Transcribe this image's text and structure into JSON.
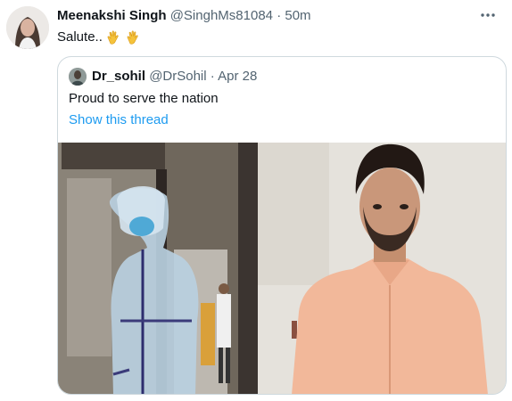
{
  "tweet": {
    "name": "Meenakshi Singh",
    "handle": "@SinghMs81084",
    "separator": "·",
    "time": "50m",
    "text": "Salute..",
    "more_icon": "more-horizontal-icon",
    "emojis": [
      "clapping-hands-icon",
      "clapping-hands-icon"
    ]
  },
  "quoted": {
    "name": "Dr_sohil",
    "handle": "@DrSohil",
    "separator": "·",
    "date": "Apr 28",
    "text": "Proud to serve the nation",
    "show_thread": "Show this thread"
  },
  "colors": {
    "link": "#1d9bf0",
    "secondary": "#536471",
    "border": "#cfd9de"
  }
}
